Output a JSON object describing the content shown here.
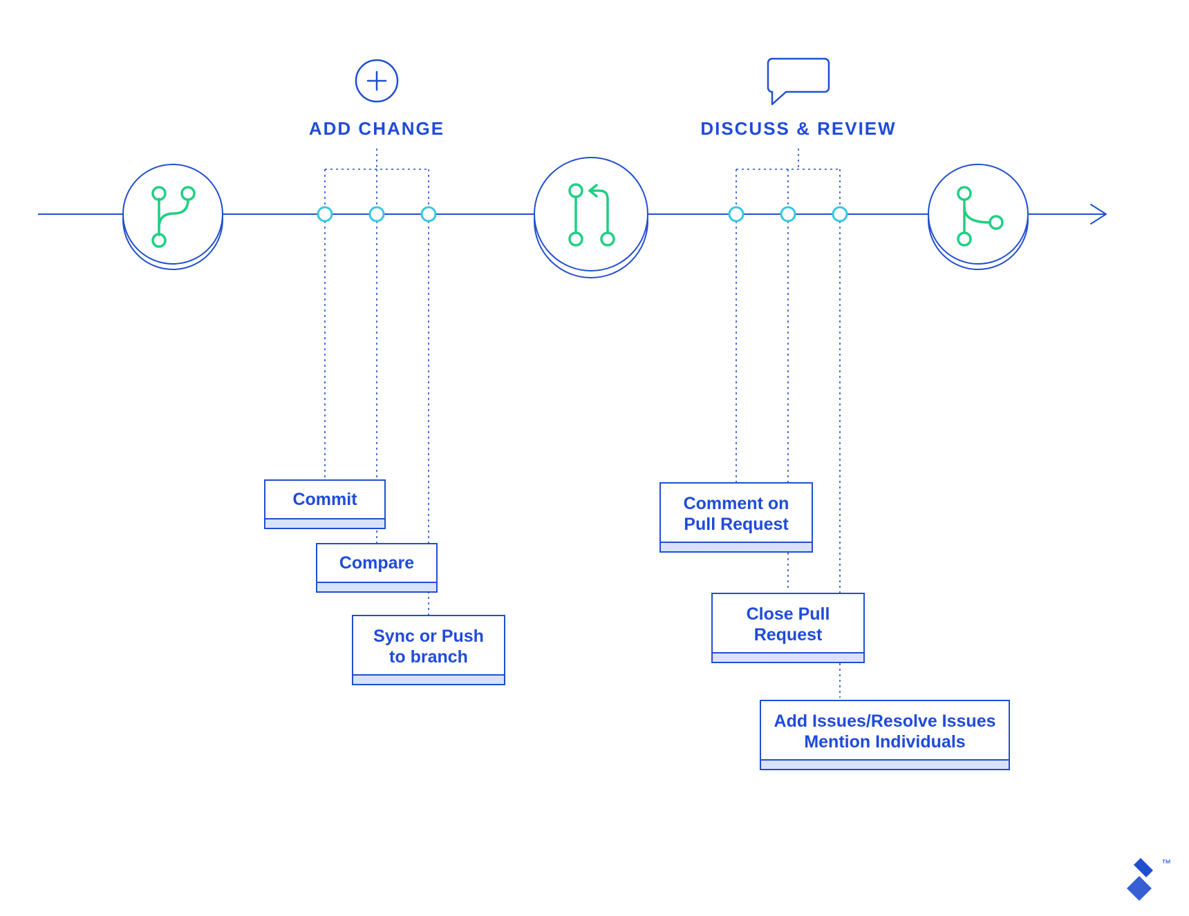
{
  "colors": {
    "blue": "#204ecf",
    "blueStroke": "#2a56d6",
    "cyan": "#35c7e3",
    "cyanFill": "#ffffff",
    "green": "#1fcf83",
    "boxFill": "#ffffff",
    "shadow": "#d9e2fb"
  },
  "sections": {
    "addChange": {
      "title": "ADD CHANGE",
      "items": [
        "Commit",
        "Compare",
        "Sync or Push",
        "to branch"
      ]
    },
    "discussReview": {
      "title": "DISCUSS & REVIEW",
      "items": [
        "Comment on",
        "Pull Request",
        "Close Pull",
        "Request",
        "Add Issues/Resolve Issues",
        "Mention Individuals"
      ]
    }
  },
  "watermark": "™"
}
